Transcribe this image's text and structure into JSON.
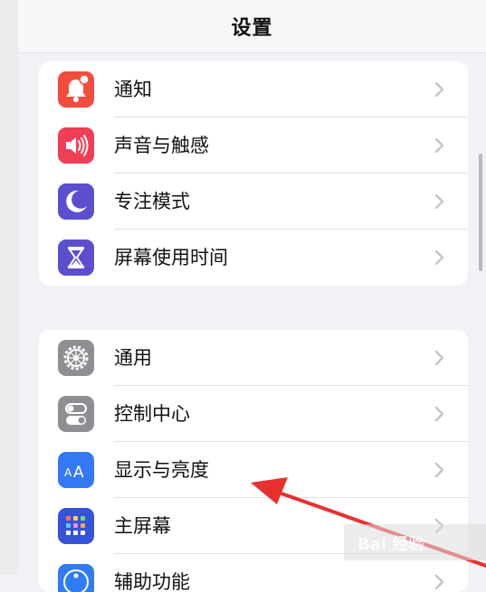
{
  "header": {
    "title": "设置"
  },
  "group1": {
    "items": [
      {
        "label": "通知",
        "icon": "bell-badge-icon",
        "color": "#f24c3e"
      },
      {
        "label": "声音与触感",
        "icon": "speaker-icon",
        "color": "#f03e56"
      },
      {
        "label": "专注模式",
        "icon": "moon-icon",
        "color": "#5b4fcf"
      },
      {
        "label": "屏幕使用时间",
        "icon": "hourglass-icon",
        "color": "#5b4fcf"
      }
    ]
  },
  "group2": {
    "items": [
      {
        "label": "通用",
        "icon": "gear-icon",
        "color": "#8e8e93"
      },
      {
        "label": "控制中心",
        "icon": "toggle-switches-icon",
        "color": "#8e8e93"
      },
      {
        "label": "显示与亮度",
        "icon": "text-size-icon",
        "color": "#3478f6"
      },
      {
        "label": "主屏幕",
        "icon": "home-grid-icon",
        "color": "#3453d8"
      },
      {
        "label": "辅助功能",
        "icon": "accessibility-icon",
        "color": "#2f7cf6"
      }
    ]
  },
  "annotation": {
    "color": "#e8302e"
  },
  "watermark": {
    "text": "Bai 经验"
  }
}
